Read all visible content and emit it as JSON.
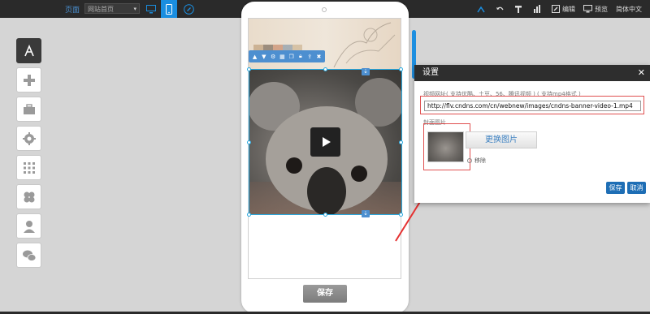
{
  "topbar": {
    "pages_label": "页面",
    "page_select": "网站首页",
    "tools": [
      {
        "icon": "publish-icon",
        "label": ""
      },
      {
        "icon": "undo-icon",
        "label": ""
      },
      {
        "icon": "hammer-icon",
        "label": ""
      },
      {
        "icon": "chart-icon",
        "label": ""
      },
      {
        "icon": "edit-icon",
        "label": "编辑"
      },
      {
        "icon": "monitor-icon",
        "label": "预览"
      },
      {
        "icon": "language-icon",
        "label": "简体中文"
      }
    ]
  },
  "sidebar": {
    "items": [
      "app-store-icon",
      "plus-icon",
      "toolbox-icon",
      "gear-icon",
      "grid-icon",
      "clover-icon",
      "user-icon",
      "wechat-icon"
    ]
  },
  "phone": {
    "save_label": "保存"
  },
  "dialog": {
    "title": "设置",
    "url_label": "视频网址( 支持优酷、土豆、56、腾讯视频 ) ( 支持mp4格式 )",
    "url_value": "http://flv.cndns.com/cn/webnew/images/cndns-banner-video-1.mp4",
    "cover_label": "封面图片",
    "replace_label": "更换图片",
    "remove_label": "移除",
    "save_label": "保存",
    "cancel_label": "取消"
  },
  "colors": {
    "accent": "#1a8ee0",
    "selection": "#28a9e0",
    "annotation": "#e05050"
  }
}
